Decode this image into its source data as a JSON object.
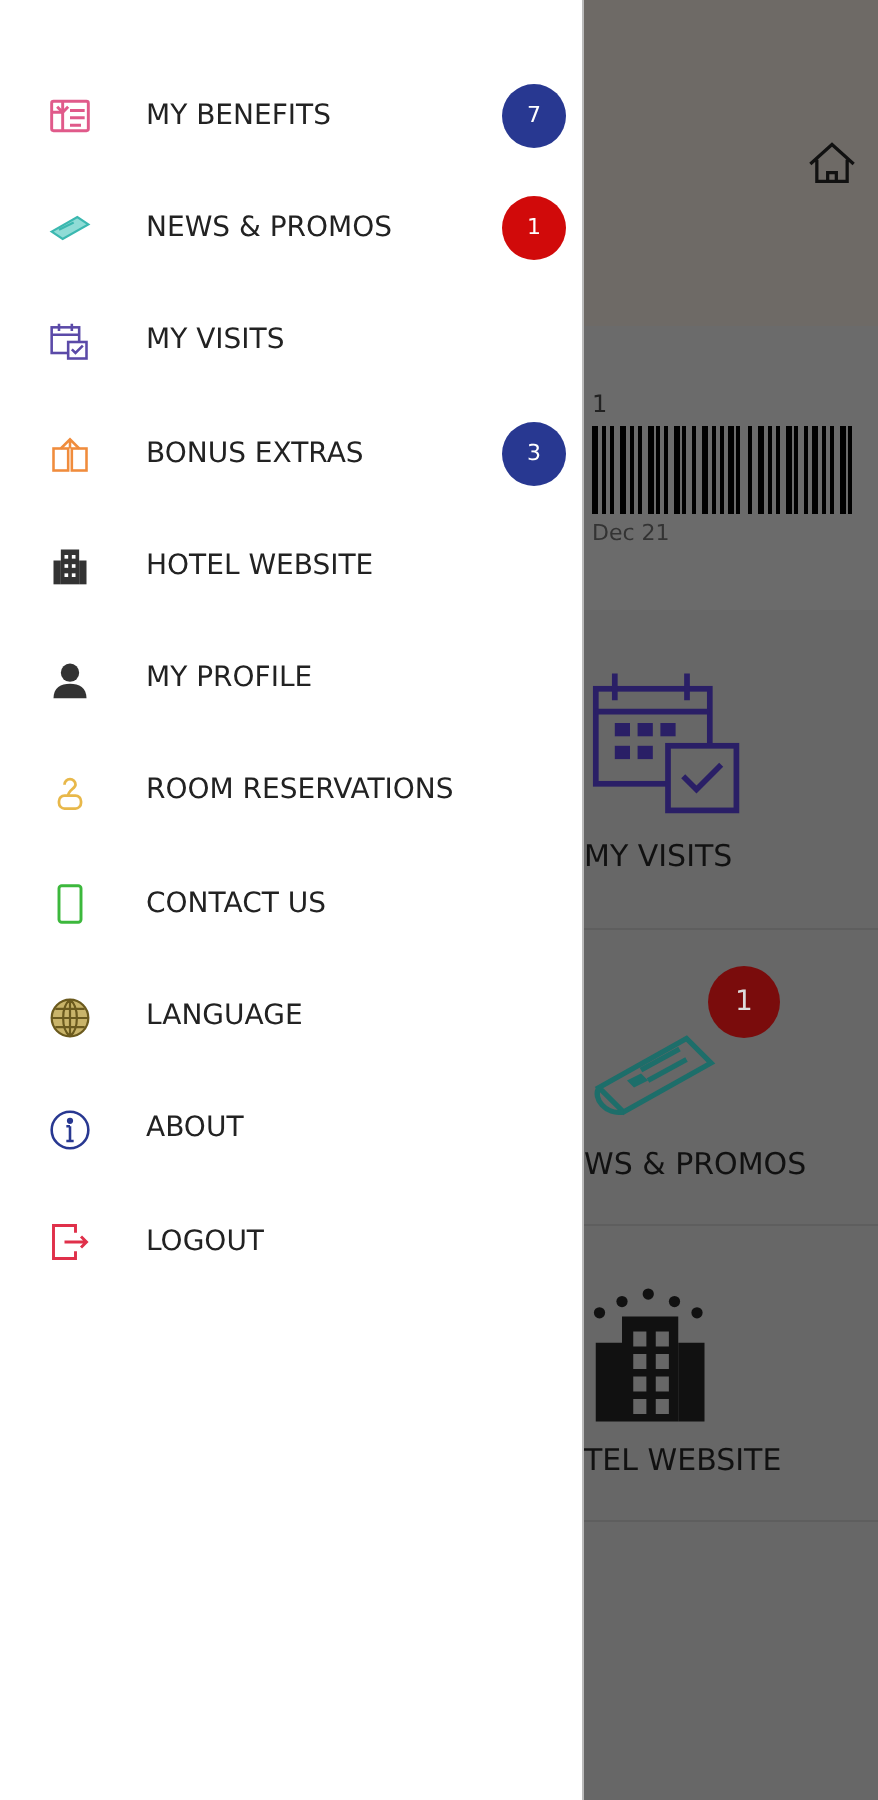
{
  "drawer": {
    "items": [
      {
        "label": "MY BENEFITS",
        "badge": {
          "text": "7",
          "color": "#283891"
        }
      },
      {
        "label": "NEWS & PROMOS",
        "badge": {
          "text": "1",
          "color": "#d10a0a"
        }
      },
      {
        "label": "MY VISITS"
      },
      {
        "label": "BONUS EXTRAS",
        "badge": {
          "text": "3",
          "color": "#283891"
        }
      },
      {
        "label": "HOTEL WEBSITE"
      },
      {
        "label": "MY PROFILE"
      },
      {
        "label": "ROOM RESERVATIONS"
      },
      {
        "label": "CONTACT US"
      },
      {
        "label": "LANGUAGE"
      },
      {
        "label": "ABOUT"
      },
      {
        "label": "LOGOUT"
      }
    ]
  },
  "background": {
    "card": {
      "number": "1",
      "date": "Dec 21"
    },
    "tiles": [
      {
        "label": "MY VISITS"
      },
      {
        "label": "WS & PROMOS",
        "badge": "1"
      },
      {
        "label": "TEL WEBSITE"
      }
    ]
  }
}
